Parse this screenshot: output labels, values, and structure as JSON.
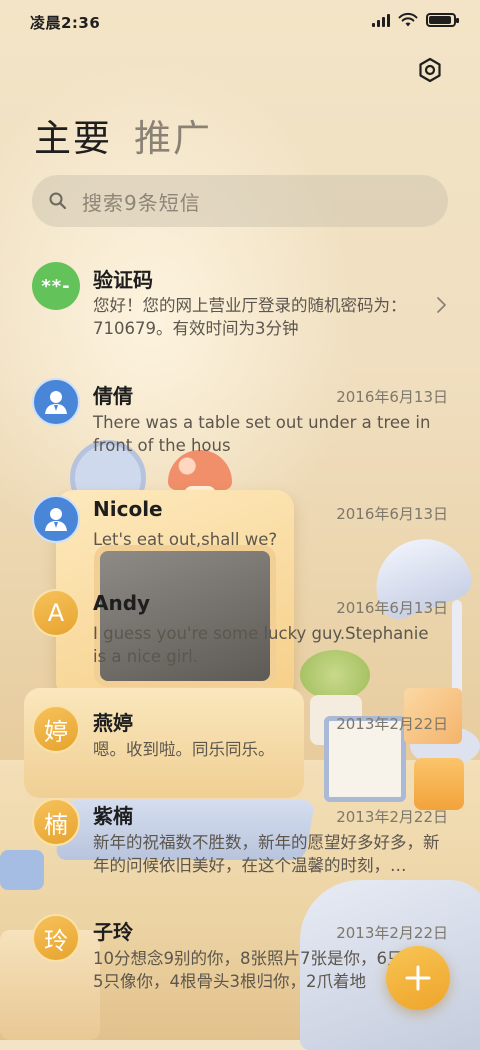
{
  "status_bar": {
    "time": "凌晨2:36"
  },
  "tabs": [
    {
      "label": "主要",
      "active": true
    },
    {
      "label": "推广",
      "active": false
    }
  ],
  "search": {
    "placeholder": "搜索9条短信"
  },
  "conversations": [
    {
      "name": "验证码",
      "date": "",
      "avatar_text": "**-",
      "avatar_type": "code",
      "snippet": "您好！您的网上营业厅登录的随机密码为：710679。有效时间为3分钟"
    },
    {
      "name": "倩倩",
      "date": "2016年6月13日",
      "avatar_text": "",
      "avatar_type": "person-icon",
      "snippet": "There was a table set out under a tree in front of the hous"
    },
    {
      "name": "Nicole",
      "date": "2016年6月13日",
      "avatar_text": "",
      "avatar_type": "person-icon",
      "snippet": "Let's eat out,shall we?"
    },
    {
      "name": "Andy",
      "date": "2016年6月13日",
      "avatar_text": "A",
      "avatar_type": "letter",
      "snippet": "I guess you're some lucky guy.Stephanie is a nice girl."
    },
    {
      "name": "燕婷",
      "date": "2013年2月22日",
      "avatar_text": "婷",
      "avatar_type": "letter",
      "snippet": "嗯。收到啦。同乐同乐。"
    },
    {
      "name": "紫楠",
      "date": "2013年2月22日",
      "avatar_text": "楠",
      "avatar_type": "letter",
      "snippet": "新年的祝福数不胜数，新年的愿望好多好多，新年的问候依旧美好，在这个温馨的时刻，…"
    },
    {
      "name": "子玲",
      "date": "2013年2月22日",
      "avatar_text": "玲",
      "avatar_type": "letter",
      "snippet": "10分想念9别的你，8张照片7张是你，6只小狗5只像你，4根骨头3根归你，2爪着地"
    }
  ],
  "colors": {
    "accent": "#f0a93a",
    "code_avatar": "#63c35a",
    "person_avatar": "#4a86d8"
  }
}
